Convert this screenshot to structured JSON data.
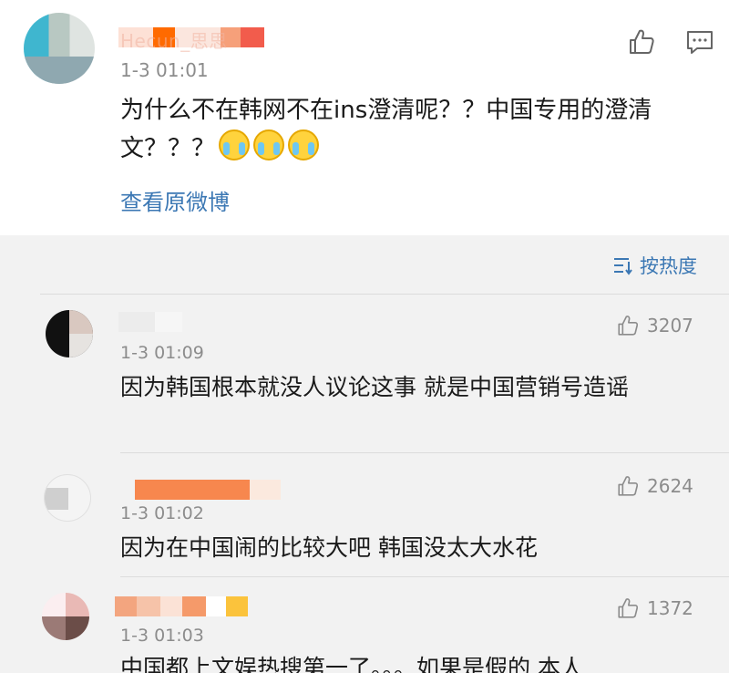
{
  "post": {
    "username": "Hecun_思思",
    "time": "1-3 01:01",
    "text": "为什么不在韩网不在ins澄清呢？？中国专用的澄清文？？？",
    "emoji_count": 3,
    "emoji_name": "laughing-crying-emoji",
    "view_original": "查看原微博",
    "icons": {
      "like": "thumbs-up-icon",
      "comment": "comment-icon"
    }
  },
  "sort": {
    "label": "按热度",
    "icon": "sort-icon"
  },
  "comments": [
    {
      "time": "1-3 01:09",
      "text": "因为韩国根本就没人议论这事 就是中国营销号造谣",
      "likes": "3207"
    },
    {
      "time": "1-3 01:02",
      "text": "因为在中国闹的比较大吧 韩国没太大水花",
      "likes": "2624"
    },
    {
      "time": "1-3 01:03",
      "text": "中国都上文娱热搜第一了。。。如果是假的 本人",
      "likes": "1372"
    }
  ],
  "colors": {
    "link": "#3c78b4",
    "text": "#1a1a1a",
    "meta": "#8c8c8c",
    "background": "#f2f2f2",
    "card": "#ffffff"
  }
}
